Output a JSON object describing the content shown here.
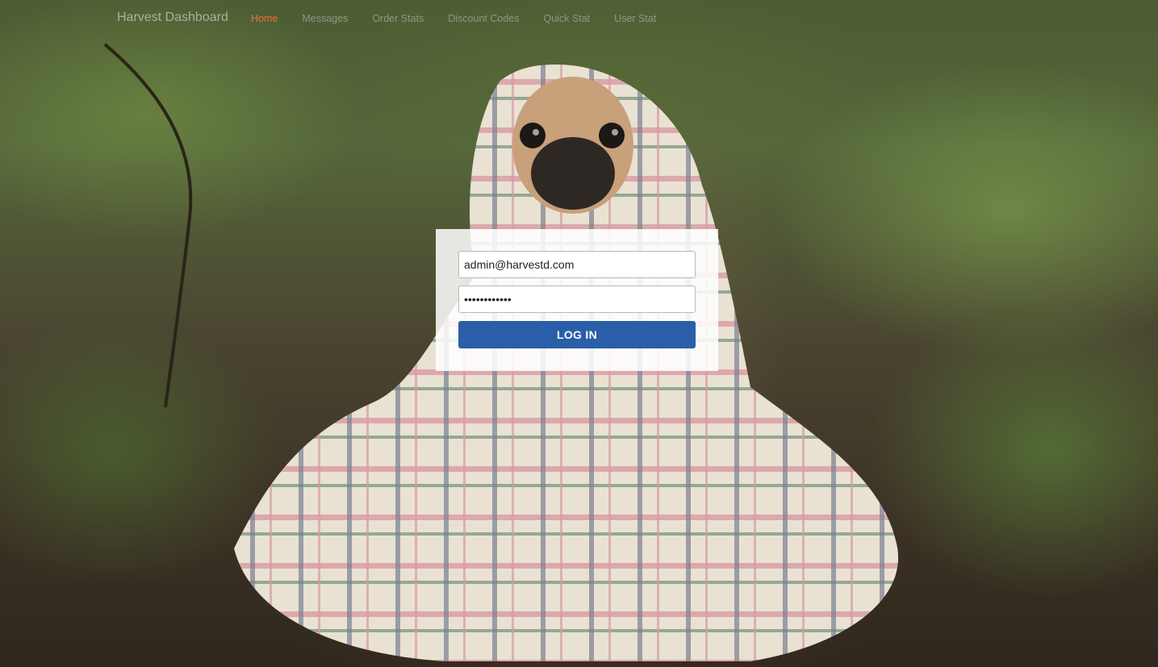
{
  "navbar": {
    "brand": "Harvest Dashboard",
    "items": [
      {
        "label": "Home",
        "active": true
      },
      {
        "label": "Messages",
        "active": false
      },
      {
        "label": "Order Stats",
        "active": false
      },
      {
        "label": "Discount Codes",
        "active": false
      },
      {
        "label": "Quick Stat",
        "active": false
      },
      {
        "label": "User Stat",
        "active": false
      }
    ],
    "active_color": "#e8703a"
  },
  "login": {
    "email_value": "admin@harvestd.com",
    "password_value": "••••••••••••",
    "button_label": "LOG IN",
    "button_color": "#2b5ea8"
  },
  "background": {
    "image": "pug-in-blanket-forest-photo"
  }
}
